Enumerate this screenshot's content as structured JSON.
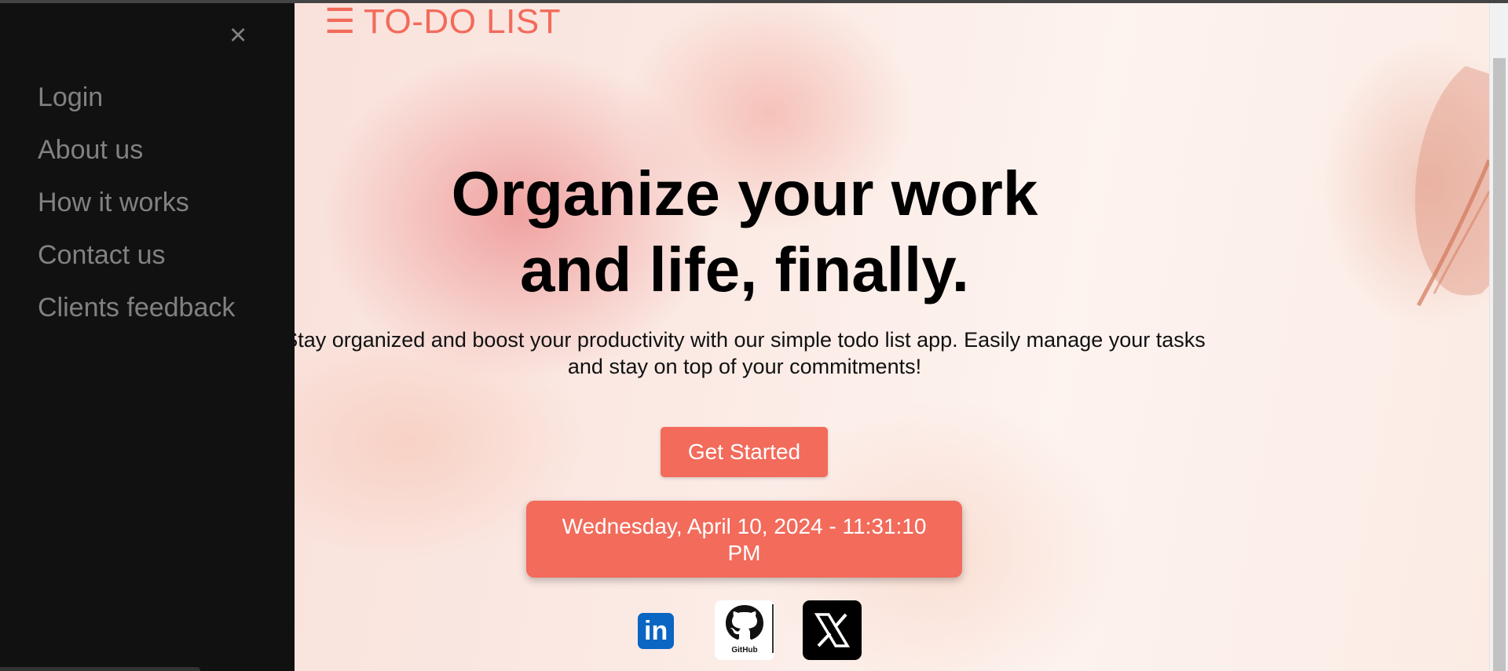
{
  "header": {
    "menu_glyph": "☰",
    "brand": "TO-DO LIST"
  },
  "sidebar": {
    "close_glyph": "×",
    "items": [
      {
        "label": "Login"
      },
      {
        "label": "About us"
      },
      {
        "label": "How it works"
      },
      {
        "label": "Contact us"
      },
      {
        "label": "Clients feedback"
      }
    ]
  },
  "hero": {
    "title_line1": "Organize your work",
    "title_line2": "and life, finally.",
    "subtitle_line1": "Stay organized and boost your productivity with our simple todo list app. Easily manage your tasks",
    "subtitle_line2": "and stay on top of your commitments!",
    "cta_label": "Get Started"
  },
  "clock": {
    "line1": "Wednesday, April 10, 2024 - 11:31:10",
    "line2": "PM"
  },
  "social": {
    "linkedin_text": "in",
    "github_text": "GitHub",
    "x_icon": "x-logo"
  },
  "colors": {
    "accent": "#f26b5b",
    "sidebar_bg": "#111111",
    "sidebar_text": "#818181",
    "linkedin": "#0a66c2"
  }
}
